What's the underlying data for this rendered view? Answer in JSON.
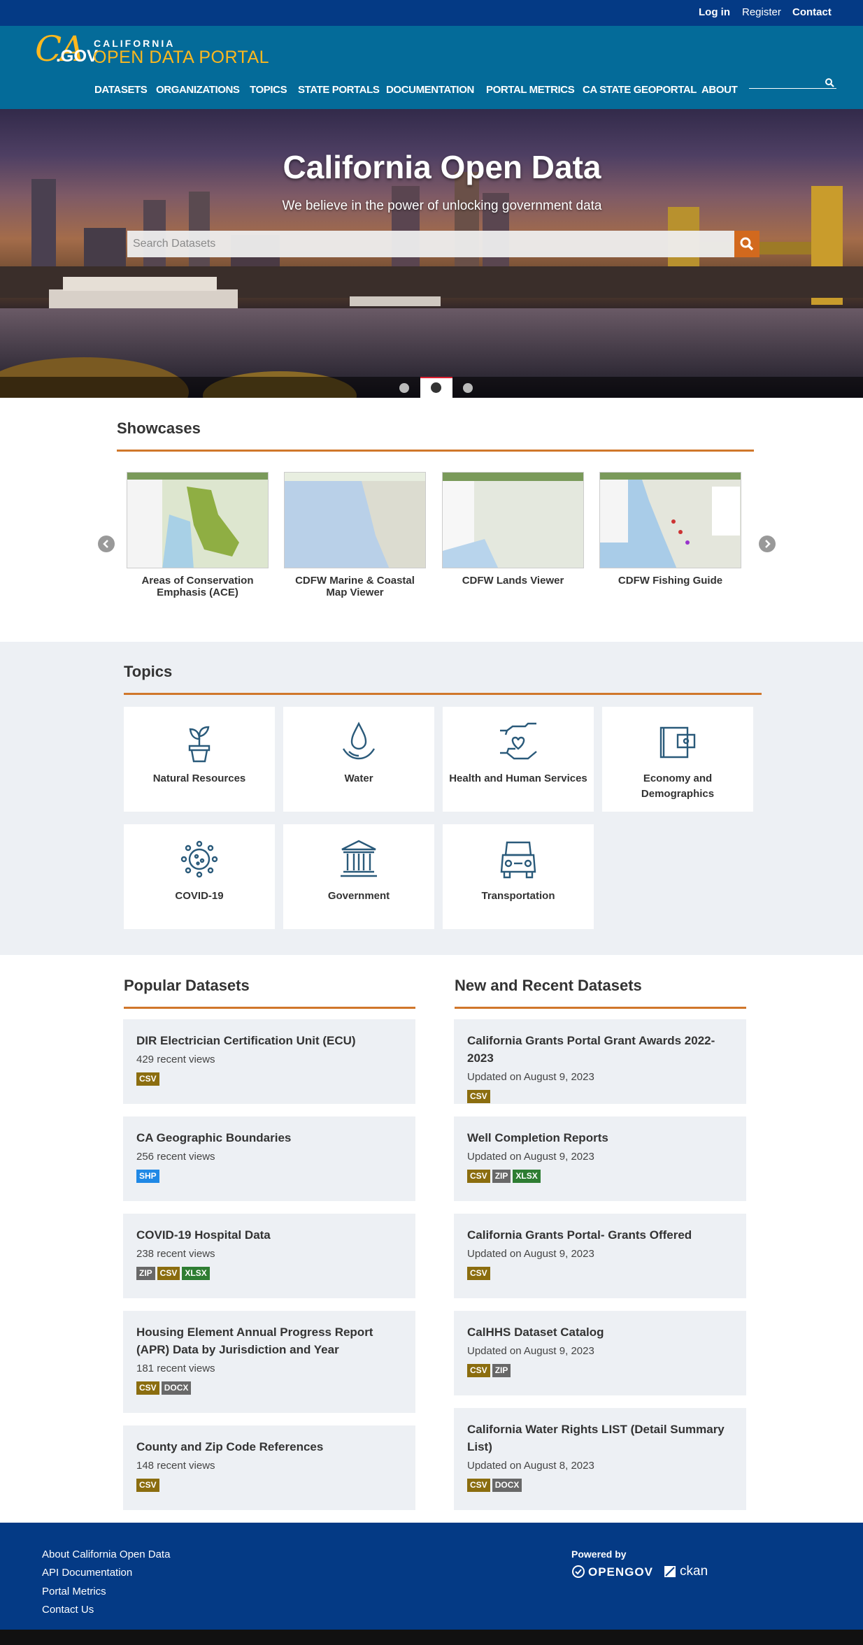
{
  "util": {
    "login": "Log in",
    "register": "Register",
    "contact": "Contact"
  },
  "logo": {
    "ca": "CA",
    "gov": ".GOV",
    "california": "CALIFORNIA",
    "portal": "OPEN DATA PORTAL"
  },
  "nav": [
    "DATASETS",
    "ORGANIZATIONS",
    "TOPICS",
    "STATE PORTALS",
    "DOCUMENTATION",
    "PORTAL METRICS",
    "CA STATE GEOPORTAL",
    "ABOUT"
  ],
  "hero": {
    "title": "California Open Data",
    "subtitle": "We believe in the power of unlocking government data",
    "search_placeholder": "Search Datasets"
  },
  "showcases": {
    "heading": "Showcases",
    "items": [
      {
        "title": "Areas of Conservation Emphasis (ACE)"
      },
      {
        "title": "CDFW Marine & Coastal Map Viewer"
      },
      {
        "title": "CDFW Lands Viewer"
      },
      {
        "title": "CDFW Fishing Guide"
      }
    ]
  },
  "topics": {
    "heading": "Topics",
    "items": [
      {
        "label": "Natural Resources",
        "icon": "plant-icon"
      },
      {
        "label": "Water",
        "icon": "water-drop-icon"
      },
      {
        "label": "Health and Human Services",
        "icon": "heart-hand-icon"
      },
      {
        "label": "Economy and Demographics",
        "icon": "wallet-icon"
      },
      {
        "label": "COVID-19",
        "icon": "virus-icon"
      },
      {
        "label": "Government",
        "icon": "capitol-building-icon"
      },
      {
        "label": "Transportation",
        "icon": "bus-icon"
      }
    ]
  },
  "popular": {
    "heading": "Popular Datasets",
    "items": [
      {
        "title": "DIR Electrician Certification Unit (ECU)",
        "meta": "429 recent views",
        "tags": [
          "CSV"
        ]
      },
      {
        "title": "CA Geographic Boundaries",
        "meta": "256 recent views",
        "tags": [
          "SHP"
        ]
      },
      {
        "title": "COVID-19 Hospital Data",
        "meta": "238 recent views",
        "tags": [
          "ZIP",
          "CSV",
          "XLSX"
        ]
      },
      {
        "title": "Housing Element Annual Progress Report (APR) Data by Jurisdiction and Year",
        "meta": "181 recent views",
        "tags": [
          "CSV",
          "DOCX"
        ]
      },
      {
        "title": "County and Zip Code References",
        "meta": "148 recent views",
        "tags": [
          "CSV"
        ]
      }
    ]
  },
  "recent": {
    "heading": "New and Recent Datasets",
    "items": [
      {
        "title": "California Grants Portal Grant Awards 2022-2023",
        "meta": "Updated on August 9, 2023",
        "tags": [
          "CSV"
        ]
      },
      {
        "title": "Well Completion Reports",
        "meta": "Updated on August 9, 2023",
        "tags": [
          "CSV",
          "ZIP",
          "XLSX"
        ]
      },
      {
        "title": "California Grants Portal- Grants Offered",
        "meta": "Updated on August 9, 2023",
        "tags": [
          "CSV"
        ]
      },
      {
        "title": "CalHHS Dataset Catalog",
        "meta": "Updated on August 9, 2023",
        "tags": [
          "CSV",
          "ZIP"
        ]
      },
      {
        "title": "California Water Rights LIST (Detail Summary List)",
        "meta": "Updated on August 8, 2023",
        "tags": [
          "CSV",
          "DOCX"
        ]
      }
    ]
  },
  "tag_colors": {
    "CSV": "#8b6d0f",
    "ZIP": "#686868",
    "XLSX": "#2e7d32",
    "SHP": "#1f88e5",
    "DOCX": "#686868"
  },
  "footer": {
    "links": [
      "About California Open Data",
      "API Documentation",
      "Portal Metrics",
      "Contact Us"
    ],
    "powered_by": "Powered by",
    "opengov": "OPENGOV",
    "ckan": "ckan"
  },
  "colors": {
    "util_bar": "#043a85",
    "header": "#046b99",
    "accent": "#d0772b",
    "gold": "#fdb81e"
  }
}
